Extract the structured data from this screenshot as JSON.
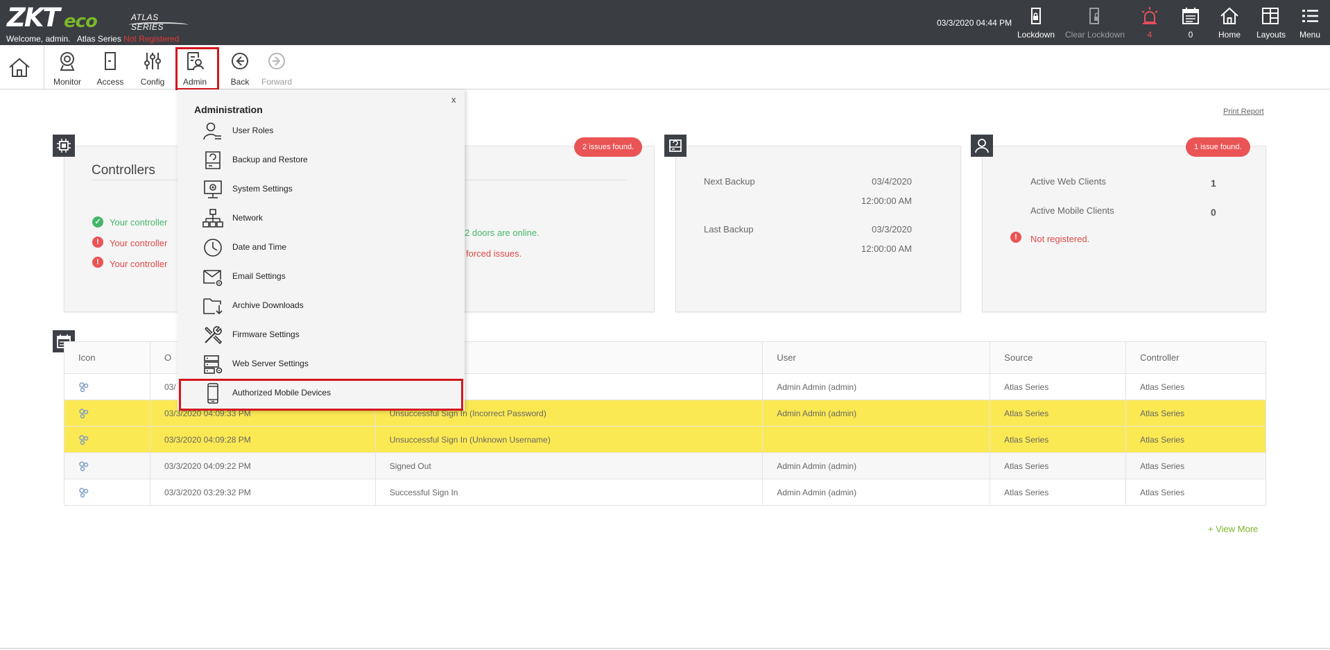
{
  "header": {
    "logo": {
      "zk": "ZKT",
      "eco": "eco"
    },
    "atlas_badge": "ATLAS SERIES",
    "welcome": "Welcome, admin.",
    "system_name": "Atlas Series",
    "registration_status": "Not Registered",
    "datetime": "03/3/2020 04:44 PM",
    "buttons": {
      "lockdown": "Lockdown",
      "clear_lockdown": "Clear Lockdown",
      "alarms_count": "4",
      "events_count": "0",
      "home": "Home",
      "layouts": "Layouts",
      "menu": "Menu"
    },
    "colors": {
      "bar": "#3a3d42",
      "alarm": "#e8505b",
      "brand_green": "#78b72a"
    }
  },
  "nav": {
    "monitor": "Monitor",
    "access": "Access",
    "config": "Config",
    "admin": "Admin",
    "back": "Back",
    "forward": "Forward"
  },
  "dashboard": {
    "print_report": "Print Report",
    "controllers": {
      "title": "Controllers",
      "issues_badge": "2 issues found.",
      "lines": [
        {
          "type": "ok",
          "text": "Your controller"
        },
        {
          "type": "err",
          "text": "Your controller"
        },
        {
          "type": "err",
          "text": "Your controller"
        }
      ],
      "doors_online": "2 doors are online.",
      "forced_issues": "forced issues."
    },
    "backup": {
      "next_label": "Next Backup",
      "next_date": "03/4/2020",
      "next_time": "12:00:00 AM",
      "last_label": "Last Backup",
      "last_date": "03/3/2020",
      "last_time": "12:00:00 AM"
    },
    "license": {
      "issues_badge": "1 issue found.",
      "web_label": "Active Web Clients",
      "web_value": "1",
      "mobile_label": "Active Mobile Clients",
      "mobile_value": "0",
      "status": "Not registered."
    }
  },
  "events": {
    "columns": [
      "Icon",
      "O",
      "",
      "User",
      "Source",
      "Controller"
    ],
    "rows": [
      {
        "time": "03/",
        "event": "",
        "user": "Admin Admin (admin)",
        "source": "Atlas Series",
        "controller": "Atlas Series",
        "highlight": false
      },
      {
        "time": "03/3/2020 04:09:33 PM",
        "event": "Unsuccessful Sign In (Incorrect Password)",
        "user": "Admin Admin (admin)",
        "source": "Atlas Series",
        "controller": "Atlas Series",
        "highlight": true
      },
      {
        "time": "03/3/2020 04:09:28 PM",
        "event": "Unsuccessful Sign In (Unknown Username)",
        "user": "",
        "source": "Atlas Series",
        "controller": "Atlas Series",
        "highlight": true
      },
      {
        "time": "03/3/2020 04:09:22 PM",
        "event": "Signed Out",
        "user": "Admin Admin (admin)",
        "source": "Atlas Series",
        "controller": "Atlas Series",
        "highlight": false
      },
      {
        "time": "03/3/2020 03:29:32 PM",
        "event": "Successful Sign In",
        "user": "Admin Admin (admin)",
        "source": "Atlas Series",
        "controller": "Atlas Series",
        "highlight": false
      }
    ],
    "view_more": "+ View More",
    "highlight_color": "#fbe953"
  },
  "admin_menu": {
    "close": "x",
    "title": "Administration",
    "items": [
      {
        "label": "User Roles",
        "icon": "user-roles-icon"
      },
      {
        "label": "Backup and Restore",
        "icon": "backup-restore-icon"
      },
      {
        "label": "System Settings",
        "icon": "system-settings-icon"
      },
      {
        "label": "Network",
        "icon": "network-icon"
      },
      {
        "label": "Date and Time",
        "icon": "clock-icon"
      },
      {
        "label": "Email Settings",
        "icon": "email-settings-icon"
      },
      {
        "label": "Archive Downloads",
        "icon": "archive-downloads-icon"
      },
      {
        "label": "Firmware Settings",
        "icon": "firmware-settings-icon"
      },
      {
        "label": "Web Server Settings",
        "icon": "web-server-icon"
      },
      {
        "label": "Authorized Mobile Devices",
        "icon": "mobile-device-icon"
      }
    ],
    "highlight_color": "#d3171c"
  }
}
